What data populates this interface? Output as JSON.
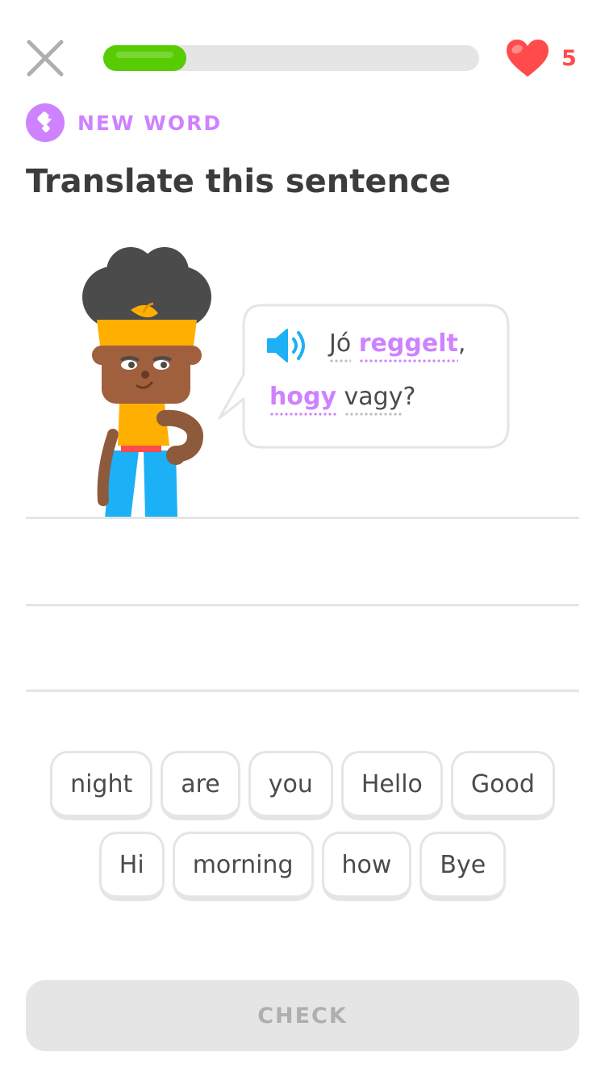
{
  "header": {
    "close_icon": "close-icon",
    "progress": 0.22,
    "progress_color": "#58cc02",
    "hearts_icon": "heart-icon",
    "hearts_count": "5",
    "hearts_color": "#ff4b4b"
  },
  "badge": {
    "icon": "new-word-icon",
    "label": "NEW WORD",
    "color": "#ce82ff"
  },
  "prompt": {
    "title": "Translate this sentence"
  },
  "character": {
    "icon": "character-illustration"
  },
  "bubble": {
    "speaker_icon": "speaker-icon",
    "line1": {
      "word1": "Jó",
      "word2": "reggelt",
      "punct": ","
    },
    "line2": {
      "word1": "hogy",
      "word2": "vagy",
      "punct": "?"
    },
    "highlight_color": "#ce82ff"
  },
  "word_bank": {
    "row1": [
      "night",
      "are",
      "you",
      "Hello",
      "Good"
    ],
    "row2": [
      "Hi",
      "morning",
      "how",
      "Bye"
    ]
  },
  "footer": {
    "check_label": "CHECK"
  }
}
